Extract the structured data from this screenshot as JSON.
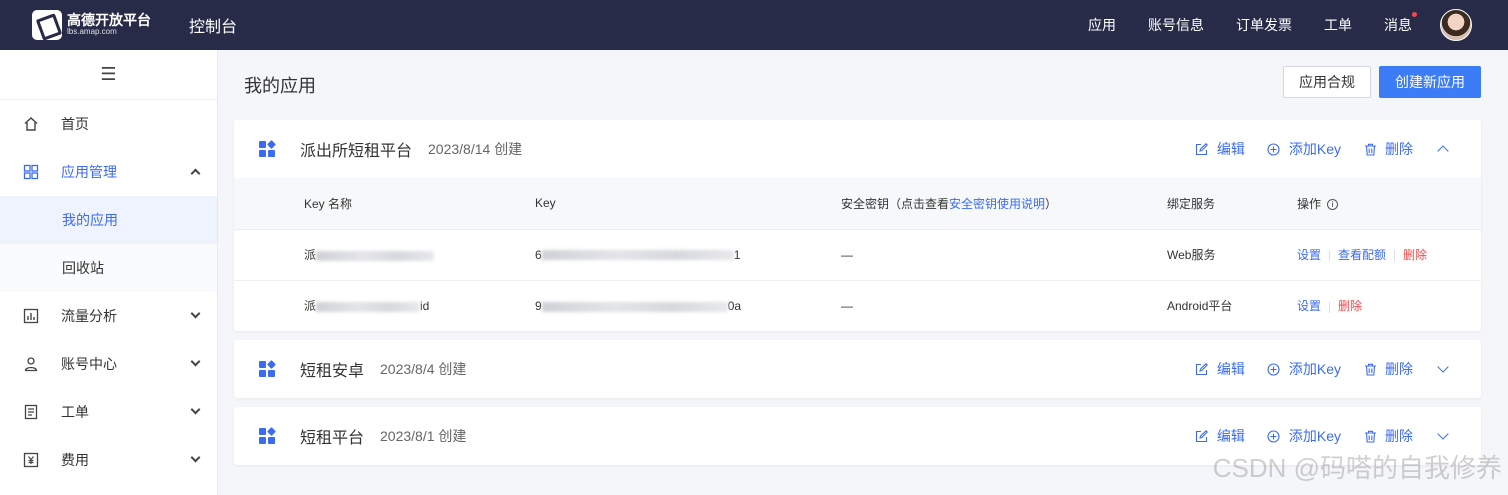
{
  "header": {
    "logo_name": "高德开放平台",
    "logo_sub": "lbs.amap.com",
    "console": "控制台",
    "nav": [
      "应用",
      "账号信息",
      "订单发票",
      "工单",
      "消息"
    ]
  },
  "sidebar": {
    "menu_icon": "☰",
    "items": [
      {
        "label": "首页",
        "icon": "home-icon"
      },
      {
        "label": "应用管理",
        "icon": "grid-icon"
      },
      {
        "label": "流量分析",
        "icon": "chart-icon"
      },
      {
        "label": "账号中心",
        "icon": "user-icon"
      },
      {
        "label": "工单",
        "icon": "ticket-icon"
      },
      {
        "label": "费用",
        "icon": "billing-icon"
      }
    ],
    "sub_items": [
      "我的应用",
      "回收站"
    ]
  },
  "main": {
    "title": "我的应用",
    "compliance_button": "应用合规",
    "create_button": "创建新应用"
  },
  "action_labels": {
    "edit": "编辑",
    "add_key": "添加Key",
    "delete": "删除"
  },
  "apps": [
    {
      "name": "派出所短租平台",
      "date": "2023/8/14 创建",
      "expanded": true,
      "table": {
        "headers": {
          "key_name": "Key 名称",
          "key": "Key",
          "secret_prefix": "安全密钥（点击查看",
          "secret_link": "安全密钥使用说明",
          "secret_suffix": "）",
          "service": "绑定服务",
          "ops": "操作"
        },
        "rows": [
          {
            "name_visible": "派",
            "key_start": "6",
            "key_mid": "104  2000  f0171  1",
            "key_end": "1",
            "secret": "—",
            "service": "Web服务",
            "ops": [
              "设置",
              "查看配额",
              "删除"
            ]
          },
          {
            "name_visible": "派",
            "name_tail": "id",
            "key_start": "9",
            "key_mid": "",
            "key_end": "0a",
            "secret": "—",
            "service": "Android平台",
            "ops": [
              "设置",
              "删除"
            ]
          }
        ]
      }
    },
    {
      "name": "短租安卓",
      "date": "2023/8/4 创建",
      "expanded": false
    },
    {
      "name": "短租平台",
      "date": "2023/8/1 创建",
      "expanded": false
    }
  ],
  "watermark": "CSDN @码嗒的自我修养"
}
